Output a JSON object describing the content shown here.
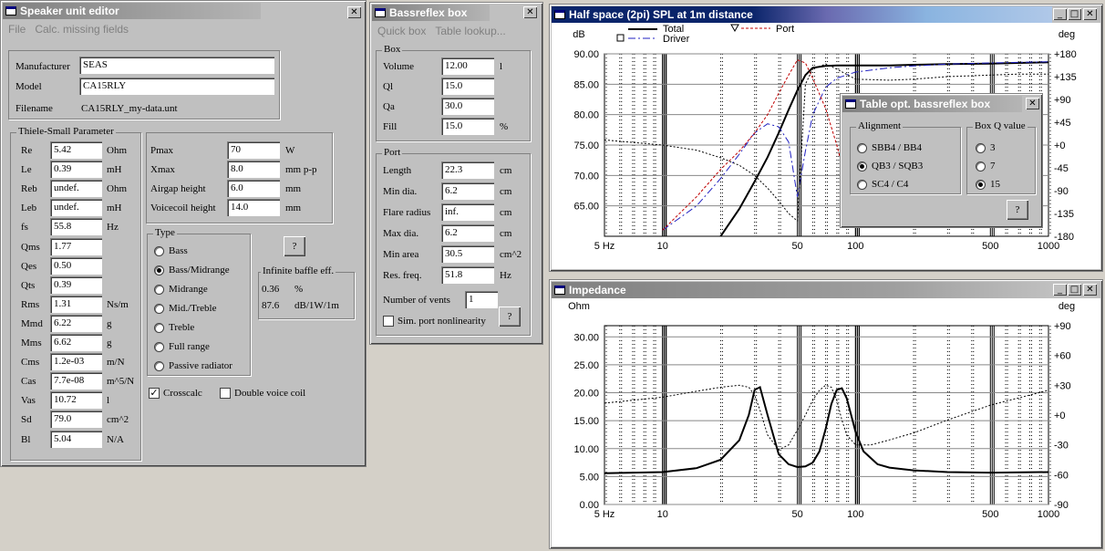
{
  "speaker_editor": {
    "title": "Speaker unit editor",
    "menu": [
      "File",
      "Calc. missing fields"
    ],
    "manufacturer_label": "Manufacturer",
    "manufacturer": "SEAS",
    "model_label": "Model",
    "model": "CA15RLY",
    "filename_label": "Filename",
    "filename": "CA15RLY_my-data.unt",
    "ts_title": "Thiele-Small Parameter",
    "ts": [
      {
        "label": "Re",
        "value": "5.42",
        "unit": "Ohm"
      },
      {
        "label": "Le",
        "value": "0.39",
        "unit": "mH"
      },
      {
        "label": "Reb",
        "value": "undef.",
        "unit": "Ohm"
      },
      {
        "label": "Leb",
        "value": "undef.",
        "unit": "mH"
      },
      {
        "label": "fs",
        "value": "55.8",
        "unit": "Hz"
      },
      {
        "label": "Qms",
        "value": "1.77",
        "unit": ""
      },
      {
        "label": "Qes",
        "value": "0.50",
        "unit": ""
      },
      {
        "label": "Qts",
        "value": "0.39",
        "unit": ""
      },
      {
        "label": "Rms",
        "value": "1.31",
        "unit": "Ns/m"
      },
      {
        "label": "Mmd",
        "value": "6.22",
        "unit": "g"
      },
      {
        "label": "Mms",
        "value": "6.62",
        "unit": "g"
      },
      {
        "label": "Cms",
        "value": "1.2e-03",
        "unit": "m/N"
      },
      {
        "label": "Cas",
        "value": "7.7e-08",
        "unit": "m^5/N"
      },
      {
        "label": "Vas",
        "value": "10.72",
        "unit": "l"
      },
      {
        "label": "Sd",
        "value": "79.0",
        "unit": "cm^2"
      },
      {
        "label": "Bl",
        "value": "5.04",
        "unit": "N/A"
      }
    ],
    "extra": [
      {
        "label": "Pmax",
        "value": "70",
        "unit": "W"
      },
      {
        "label": "Xmax",
        "value": "8.0",
        "unit": "mm p-p"
      },
      {
        "label": "Airgap height",
        "value": "6.0",
        "unit": "mm"
      },
      {
        "label": "Voicecoil height",
        "value": "14.0",
        "unit": "mm"
      }
    ],
    "type_title": "Type",
    "types": [
      "Bass",
      "Bass/Midrange",
      "Midrange",
      "Mid./Treble",
      "Treble",
      "Full range",
      "Passive radiator"
    ],
    "type_selected": 1,
    "help_label": "?",
    "ibe_title": "Infinite baffle eff.",
    "ibe_value1": "0.36",
    "ibe_unit1": "%",
    "ibe_value2": "87.6",
    "ibe_unit2": "dB/1W/1m",
    "crosscalc_label": "Crosscalc",
    "double_vc_label": "Double voice coil"
  },
  "bassreflex": {
    "title": "Bassreflex box",
    "menu": [
      "Quick box",
      "Table lookup..."
    ],
    "box_title": "Box",
    "box": [
      {
        "label": "Volume",
        "value": "12.00",
        "unit": "l"
      },
      {
        "label": "Ql",
        "value": "15.0",
        "unit": ""
      },
      {
        "label": "Qa",
        "value": "30.0",
        "unit": ""
      },
      {
        "label": "Fill",
        "value": "15.0",
        "unit": "%"
      }
    ],
    "port_title": "Port",
    "port": [
      {
        "label": "Length",
        "value": "22.3",
        "unit": "cm"
      },
      {
        "label": "Min dia.",
        "value": "6.2",
        "unit": "cm"
      },
      {
        "label": "Flare radius",
        "value": "inf.",
        "unit": "cm"
      },
      {
        "label": "Max dia.",
        "value": "6.2",
        "unit": "cm"
      },
      {
        "label": "Min area",
        "value": "30.5",
        "unit": "cm^2"
      },
      {
        "label": "Res. freq.",
        "value": "51.8",
        "unit": "Hz"
      }
    ],
    "vents_label": "Number of vents",
    "vents_value": "1",
    "sim_label": "Sim. port nonlinearity",
    "help_label": "?"
  },
  "spl_window": {
    "title": "Half space (2pi) SPL at 1m distance",
    "ylabel_left": "dB",
    "ylabel_right": "deg",
    "legend": [
      {
        "name": "Total",
        "style": "solid-thick"
      },
      {
        "name": "Driver",
        "style": "dashdot"
      },
      {
        "name": "Port",
        "style": "dashed-red"
      }
    ],
    "x_ticks": [
      "5 Hz",
      "10",
      "50",
      "100",
      "500",
      "1000"
    ],
    "y_ticks_left": [
      "90.00",
      "85.00",
      "80.00",
      "75.00",
      "70.00",
      "65.00"
    ],
    "y_ticks_right": [
      "+180",
      "+135",
      "+90",
      "+45",
      "+0",
      "-45",
      "-90",
      "-135",
      "-180"
    ]
  },
  "table_dialog": {
    "title": "Table opt. bassreflex box",
    "alignment_title": "Alignment",
    "alignments": [
      "SBB4 / BB4",
      "QB3 / SQB3",
      "SC4 / C4"
    ],
    "alignment_selected": 1,
    "boxq_title": "Box Q value",
    "boxq": [
      "3",
      "7",
      "15"
    ],
    "boxq_selected": 2,
    "help_label": "?"
  },
  "impedance_window": {
    "title": "Impedance",
    "ylabel_left": "Ohm",
    "ylabel_right": "deg",
    "x_ticks": [
      "5 Hz",
      "10",
      "50",
      "100",
      "500",
      "1000"
    ],
    "y_ticks_left": [
      "30.00",
      "25.00",
      "20.00",
      "15.00",
      "10.00",
      "5.00",
      "0.00"
    ],
    "y_ticks_right": [
      "+90",
      "+60",
      "+30",
      "+0",
      "-30",
      "-60",
      "-90"
    ]
  },
  "chart_data": [
    {
      "type": "line",
      "title": "Half space (2pi) SPL at 1m distance",
      "xlabel": "",
      "ylabel": "dB",
      "x_scale": "log",
      "xlim": [
        5,
        1000
      ],
      "ylim": [
        60,
        90
      ],
      "y2_range": [
        -180,
        180
      ],
      "grid": true,
      "legend": "top-left",
      "series": [
        {
          "name": "Total",
          "axis": "left",
          "style": "solid-thick",
          "x": [
            20,
            25,
            30,
            35,
            40,
            45,
            50,
            55,
            60,
            70,
            80,
            100,
            150,
            200,
            300,
            500,
            700,
            1000
          ],
          "y": [
            60.0,
            64.5,
            69.0,
            73.0,
            77.0,
            80.8,
            84.0,
            86.5,
            87.7,
            88.0,
            88.1,
            88.1,
            88.1,
            88.2,
            88.3,
            88.4,
            88.5,
            88.6
          ]
        },
        {
          "name": "Driver",
          "axis": "left",
          "style": "dashdot",
          "x": [
            10,
            15,
            20,
            25,
            30,
            35,
            40,
            45,
            50,
            55,
            60,
            70,
            80,
            100,
            150,
            200,
            300,
            500,
            1000
          ],
          "y": [
            61.0,
            65.0,
            69.5,
            73.5,
            77.0,
            78.5,
            78.0,
            75.5,
            66.5,
            74.0,
            80.0,
            84.5,
            86.0,
            87.0,
            87.7,
            88.0,
            88.3,
            88.5,
            88.7
          ]
        },
        {
          "name": "Port",
          "axis": "left",
          "style": "dashed-red",
          "x": [
            10,
            15,
            20,
            25,
            30,
            35,
            40,
            45,
            50,
            55,
            60,
            70,
            80,
            100
          ],
          "y": [
            61.0,
            66.5,
            71.0,
            74.0,
            77.0,
            80.0,
            83.5,
            86.5,
            89.0,
            88.5,
            86.0,
            81.0,
            75.0,
            63.0
          ]
        },
        {
          "name": "Phase",
          "axis": "right",
          "style": "dotted",
          "x": [
            5,
            10,
            15,
            20,
            25,
            30,
            35,
            40,
            45,
            50,
            55,
            60,
            70,
            80,
            100,
            150,
            200,
            300,
            500,
            700,
            1000
          ],
          "y": [
            10,
            0,
            -10,
            -25,
            -40,
            -60,
            -85,
            -110,
            -135,
            -150,
            120,
            150,
            160,
            150,
            130,
            128,
            130,
            135,
            138,
            140,
            140
          ]
        }
      ]
    },
    {
      "type": "line",
      "title": "Impedance",
      "xlabel": "",
      "ylabel": "Ohm",
      "x_scale": "log",
      "xlim": [
        5,
        1000
      ],
      "ylim": [
        0,
        32
      ],
      "y2_range": [
        -90,
        90
      ],
      "grid": true,
      "series": [
        {
          "name": "Impedance",
          "axis": "left",
          "style": "solid-thick",
          "x": [
            5,
            10,
            15,
            20,
            25,
            28,
            30,
            32,
            35,
            40,
            45,
            50,
            55,
            60,
            65,
            70,
            75,
            80,
            85,
            90,
            95,
            100,
            110,
            130,
            150,
            200,
            300,
            500,
            1000
          ],
          "y": [
            5.6,
            5.8,
            6.5,
            8.0,
            11.5,
            16.0,
            20.5,
            21.0,
            16.0,
            9.0,
            7.2,
            6.7,
            6.8,
            7.5,
            9.5,
            13.5,
            18.0,
            20.5,
            20.8,
            19.0,
            16.0,
            13.0,
            9.5,
            7.2,
            6.6,
            6.1,
            5.8,
            5.7,
            5.8
          ]
        },
        {
          "name": "Phase",
          "axis": "right",
          "style": "dotted",
          "x": [
            5,
            10,
            15,
            20,
            25,
            28,
            30,
            32,
            35,
            40,
            45,
            50,
            55,
            60,
            65,
            70,
            75,
            80,
            85,
            90,
            100,
            120,
            150,
            200,
            300,
            500,
            1000
          ],
          "y": [
            12,
            18,
            24,
            28,
            30,
            28,
            20,
            5,
            -20,
            -35,
            -30,
            -15,
            0,
            15,
            25,
            30,
            28,
            15,
            -5,
            -20,
            -30,
            -30,
            -25,
            -18,
            -5,
            10,
            25
          ]
        }
      ]
    }
  ]
}
